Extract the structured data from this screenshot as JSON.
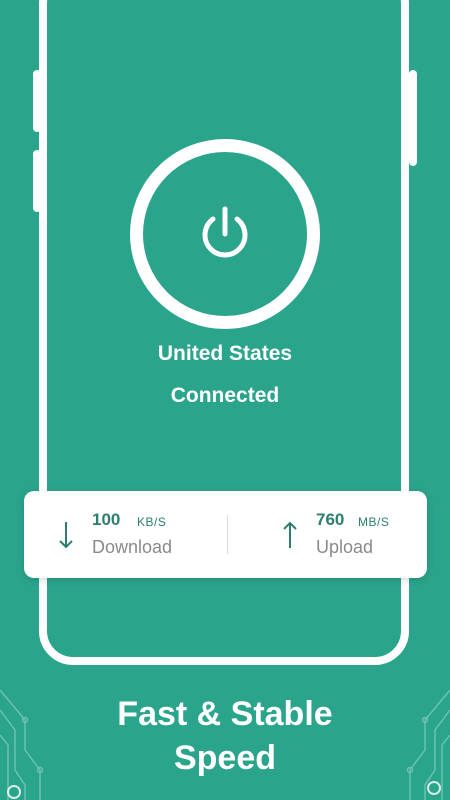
{
  "theme": {
    "background": "#2ba48c",
    "accent": "#2b7f6e",
    "card": "#ffffff"
  },
  "connection": {
    "power_icon": "power-icon",
    "location": "United States",
    "status": "Connected"
  },
  "speed": {
    "download": {
      "icon": "arrow-down-icon",
      "value": "100",
      "unit": "KB/S",
      "label": "Download"
    },
    "upload": {
      "icon": "arrow-up-icon",
      "value": "760",
      "unit": "MB/S",
      "label": "Upload"
    }
  },
  "headline": {
    "line1": "Fast & Stable",
    "line2": "Speed"
  }
}
